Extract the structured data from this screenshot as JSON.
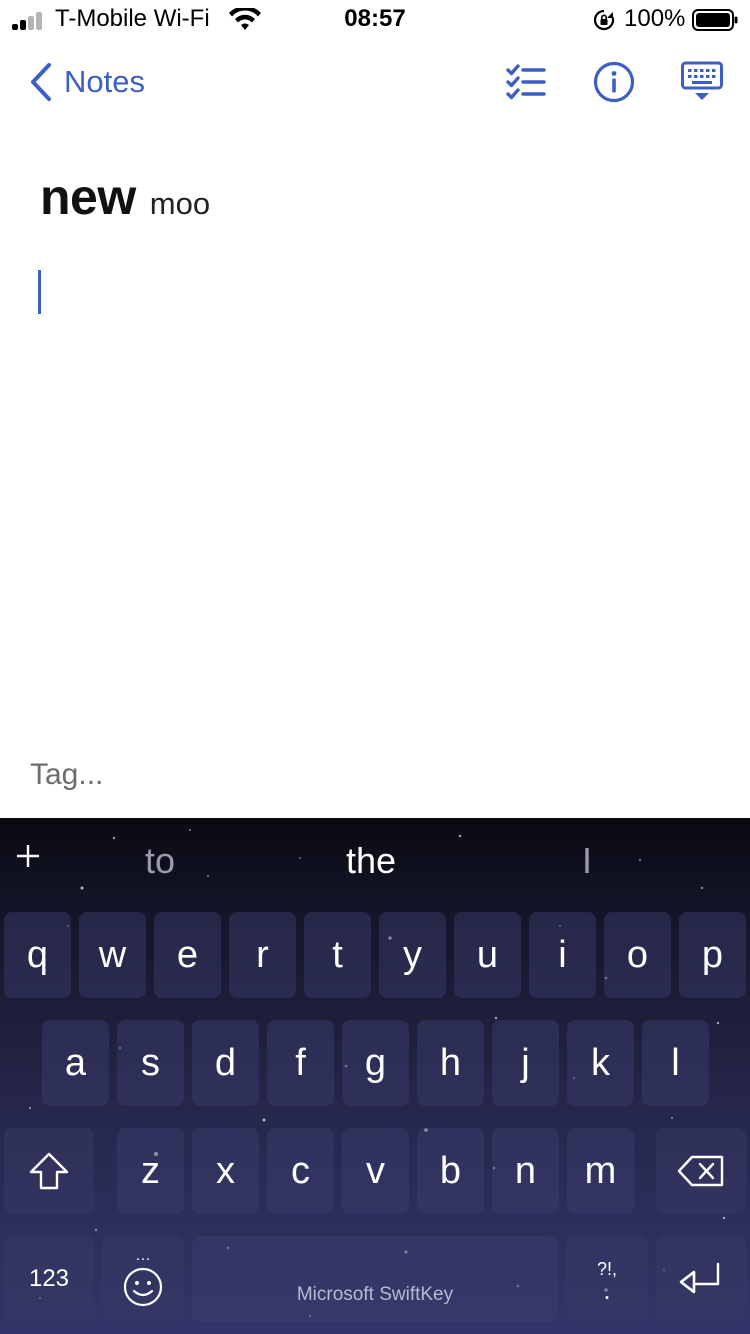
{
  "status_bar": {
    "carrier": "T-Mobile Wi-Fi",
    "time": "08:57",
    "battery_percent": "100%",
    "icons": [
      "signal-icon",
      "wifi-icon",
      "rotation-lock-icon",
      "battery-icon"
    ]
  },
  "nav": {
    "back_label": "Notes",
    "icons": [
      "chevron-left-icon",
      "checklist-icon",
      "info-icon",
      "keyboard-hide-icon"
    ],
    "accent_color": "#3d5fc4"
  },
  "note": {
    "title": "new",
    "subtitle": "moo",
    "body": ""
  },
  "tag": {
    "placeholder": "Tag..."
  },
  "keyboard": {
    "suggestions": [
      "to",
      "the",
      "I"
    ],
    "row1": [
      "q",
      "w",
      "e",
      "r",
      "t",
      "y",
      "u",
      "i",
      "o",
      "p"
    ],
    "row2": [
      "a",
      "s",
      "d",
      "f",
      "g",
      "h",
      "j",
      "k",
      "l"
    ],
    "row3": [
      "z",
      "x",
      "c",
      "v",
      "b",
      "n",
      "m"
    ],
    "numbers_label": "123",
    "space_label": "Microsoft SwiftKey",
    "punct_top": "?!,",
    "punct_bottom": ".",
    "emoji_more": "…"
  }
}
